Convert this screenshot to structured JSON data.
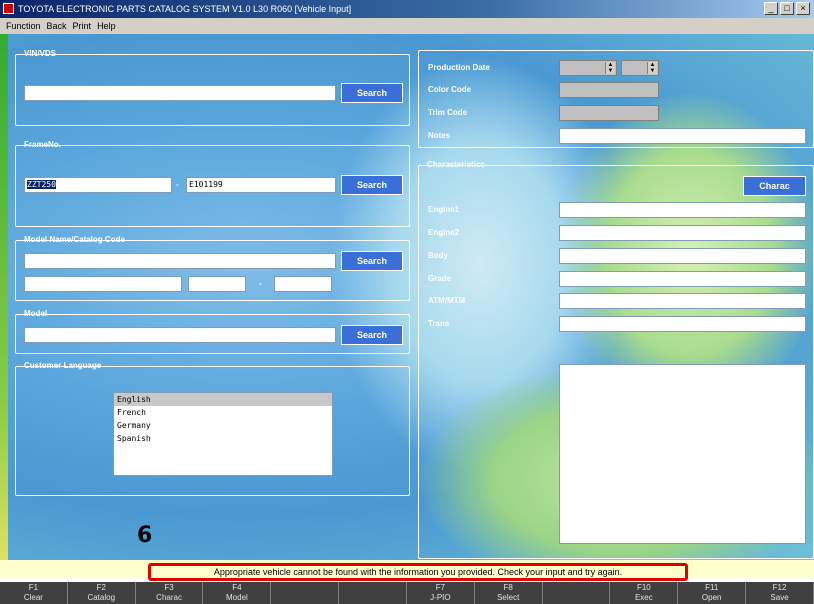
{
  "window": {
    "title": "TOYOTA ELECTRONIC PARTS CATALOG SYSTEM V1.0 L30 R060 [Vehicle Input]",
    "controls": [
      "_",
      "□",
      "×"
    ]
  },
  "menu": {
    "items": [
      "Function",
      "Back",
      "Print",
      "Help"
    ]
  },
  "left": {
    "vin_vds": {
      "label": "VIN/VDS",
      "value": "",
      "search_label": "Search"
    },
    "frame_no": {
      "label": "FrameNo.",
      "prefix": "ZZT250",
      "separator": "-",
      "number": "E101199",
      "search_label": "Search"
    },
    "model_name": {
      "label": "Model Name/Catalog Code",
      "value": "",
      "search_label": "Search",
      "separator": "-"
    },
    "model": {
      "label": "Model",
      "value": "",
      "search_label": "Search"
    },
    "language": {
      "label": "Customer Language",
      "options": [
        "English",
        "French",
        "Germany",
        "Spanish"
      ],
      "selected": "English"
    }
  },
  "right": {
    "production_date": {
      "label": "Production Date"
    },
    "color_code": {
      "label": "Color Code"
    },
    "trim_code": {
      "label": "Trim Code"
    },
    "notes": {
      "label": "Notes",
      "value": ""
    },
    "characteristics": {
      "label": "Characteristics",
      "button_label": "Charac",
      "fields": [
        {
          "label": "Engine1",
          "value": ""
        },
        {
          "label": "Engine2",
          "value": ""
        },
        {
          "label": "Body",
          "value": ""
        },
        {
          "label": "Grade",
          "value": ""
        },
        {
          "label": "ATM/MTM",
          "value": ""
        },
        {
          "label": "Trans",
          "value": ""
        }
      ]
    }
  },
  "annotation": {
    "marker": "6"
  },
  "status": {
    "message": "Appropriate vehicle cannot be found with the information you provided. Check your input and try again."
  },
  "fkeys": [
    {
      "key": "F1",
      "label": "Clear"
    },
    {
      "key": "F2",
      "label": "Catalog"
    },
    {
      "key": "F3",
      "label": "Charac"
    },
    {
      "key": "F4",
      "label": "Model"
    },
    {
      "key": "",
      "label": ""
    },
    {
      "key": "",
      "label": ""
    },
    {
      "key": "F7",
      "label": "J-PIO"
    },
    {
      "key": "F8",
      "label": "Select"
    },
    {
      "key": "",
      "label": ""
    },
    {
      "key": "F10",
      "label": "Exec"
    },
    {
      "key": "F11",
      "label": "Open"
    },
    {
      "key": "F12",
      "label": "Save"
    }
  ],
  "colors": {
    "accent_button": "#3b6fd8",
    "status_border": "#e00000",
    "status_background": "#ffffcc"
  }
}
